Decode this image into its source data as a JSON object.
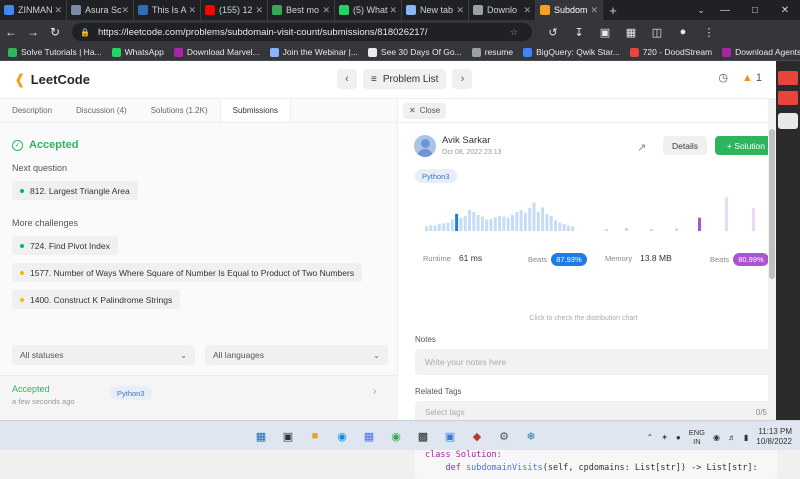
{
  "browser": {
    "tabs": [
      {
        "title": "ZINMAN",
        "color": "#4285f4"
      },
      {
        "title": "Asura Sc",
        "color": "#7c8aa5"
      },
      {
        "title": "This Is A",
        "color": "#2f6db5"
      },
      {
        "title": "(155) 12",
        "color": "#ff0000"
      },
      {
        "title": "Best mo",
        "color": "#34a853"
      },
      {
        "title": "(5) What",
        "color": "#25d366"
      },
      {
        "title": "New tab",
        "color": "#8ab4f8"
      },
      {
        "title": "Downlo",
        "color": "#9aa0a6"
      },
      {
        "title": "Subdom",
        "color": "#f89f1b"
      }
    ],
    "url": "https://leetcode.com/problems/subdomain-visit-count/submissions/818026217/",
    "bookmarks": [
      {
        "label": "Solve Tutorials | Ha...",
        "color": "#2db55d"
      },
      {
        "label": "WhatsApp",
        "color": "#25d366"
      },
      {
        "label": "Download Marvel...",
        "color": "#a626a4"
      },
      {
        "label": "Join the Webinar |...",
        "color": "#8ab4f8"
      },
      {
        "label": "See 30 Days Of Go...",
        "color": "#e8eaed"
      },
      {
        "label": "resume",
        "color": "#9aa0a6"
      },
      {
        "label": "BigQuery: Qwik Star...",
        "color": "#4285f4"
      },
      {
        "label": "720 - DoodStream",
        "color": "#e8453c"
      },
      {
        "label": "Download Agents...",
        "color": "#a626a4"
      }
    ]
  },
  "header": {
    "logo": "LeetCode",
    "problem_list": "Problem List",
    "streak": "1"
  },
  "left_panel": {
    "tabs": [
      "Description",
      "Discussion (4)",
      "Solutions (1.2K)",
      "Submissions"
    ],
    "status": "Accepted",
    "next_question_title": "Next question",
    "next_question": "812. Largest Triangle Area",
    "more_challenges_title": "More challenges",
    "challenges": [
      {
        "label": "724. Find Pivot Index",
        "difficulty": "easy"
      },
      {
        "label": "1577. Number of Ways Where Square of Number Is Equal to Product of Two Numbers",
        "difficulty": "medium"
      },
      {
        "label": "1400. Construct K Palindrome Strings",
        "difficulty": "medium"
      }
    ],
    "filter_status": "All statuses",
    "filter_language": "All languages",
    "submission": {
      "status": "Accepted",
      "time": "a few seconds ago",
      "language": "Python3"
    }
  },
  "right_panel": {
    "close": "Close",
    "user_name": "Avik Sarkar",
    "date": "Oct 08, 2022 23:13",
    "details": "Details",
    "solution": "Solution",
    "language": "Python3",
    "runtime_label": "Runtime",
    "runtime_value": "61 ms",
    "runtime_beats_label": "Beats",
    "runtime_beats": "87.93%",
    "memory_label": "Memory",
    "memory_value": "13.8 MB",
    "memory_beats_label": "Beats",
    "memory_beats": "80.99%",
    "runtime_bars": [
      0.12,
      0.15,
      0.14,
      0.18,
      0.2,
      0.22,
      0.3,
      0.45,
      0.35,
      0.4,
      0.55,
      0.5,
      0.42,
      0.38,
      0.3,
      0.32,
      0.36,
      0.4,
      0.38,
      0.35,
      0.42,
      0.5,
      0.55,
      0.48,
      0.6,
      0.75,
      0.5,
      0.62,
      0.45,
      0.4,
      0.28,
      0.22,
      0.18,
      0.14,
      0.12
    ],
    "runtime_highlight_index": 7,
    "memory_bars": [
      0.05,
      0.08,
      0.05,
      0.07,
      0.35,
      0.9,
      0.6
    ],
    "memory_highlight_index": 4,
    "dist_hint": "Click to check the distribution chart",
    "notes_label": "Notes",
    "notes_placeholder": "Write your notes here",
    "tags_label": "Related Tags",
    "tags_placeholder": "Select tags",
    "tags_count": "0/5",
    "code_line1_kw": "class",
    "code_line1_name": "Solution:",
    "code_line2_kw": "def",
    "code_line2_name": "subdomainVisits",
    "code_line2_rest": "(self, cpdomains: List[str]) -> List[str]:"
  },
  "colors": {
    "accent_green": "#2db55d",
    "beats_runtime": "#1a7ee6",
    "beats_memory": "#a855cf",
    "bar_light": "#c6dcf5",
    "bar_highlight": "#1a7ee6",
    "mem_light": "#ecd9f5",
    "mem_highlight": "#a855cf"
  },
  "taskbar": {
    "lang_line1": "ENG",
    "lang_line2": "IN",
    "time": "11:13 PM",
    "date": "10/8/2022"
  }
}
